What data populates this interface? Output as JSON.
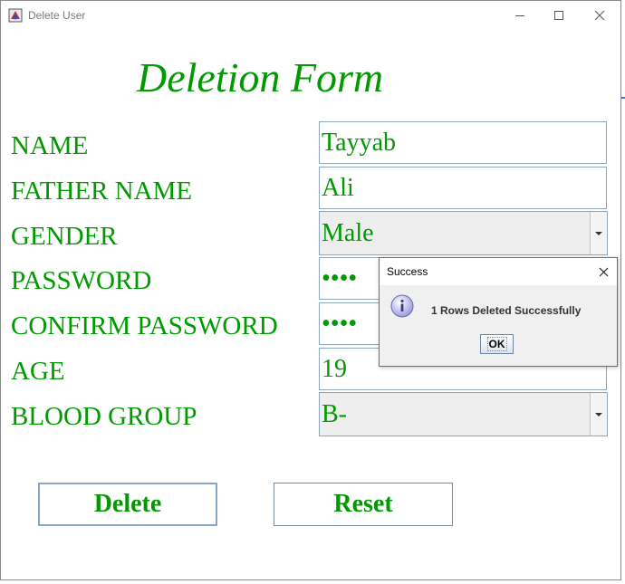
{
  "window": {
    "title": "Delete User"
  },
  "form": {
    "heading": "Deletion Form",
    "labels": {
      "name": "NAME",
      "father_name": "FATHER NAME",
      "gender": "GENDER",
      "password": "PASSWORD",
      "confirm_password": "CONFIRM PASSWORD",
      "age": "AGE",
      "blood_group": "BLOOD GROUP"
    },
    "values": {
      "name": "Tayyab",
      "father_name": "Ali",
      "gender": "Male",
      "password": "••••",
      "confirm_password": "••••",
      "age": "19",
      "blood_group": "B-"
    },
    "buttons": {
      "delete": "Delete",
      "reset": "Reset"
    }
  },
  "dialog": {
    "title": "Success",
    "message": "1 Rows Deleted Successfully",
    "ok_label": "OK"
  },
  "colors": {
    "label_green": "#009a00",
    "field_border": "#8fa5b8"
  },
  "icons": [
    "app-icon",
    "minimize-icon",
    "maximize-icon",
    "close-icon",
    "chevron-down-icon",
    "info-icon"
  ]
}
